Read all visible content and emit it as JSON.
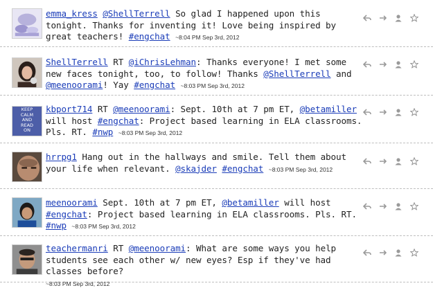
{
  "tweets": [
    {
      "user": "emma_kress",
      "parts": [
        " ",
        "@ShellTerrell",
        " So glad I happened upon this tonight. Thanks for inventing it! Love being inspired by great teachers! ",
        "#engchat"
      ],
      "timestamp": "~8:04 PM Sep 3rd, 2012"
    },
    {
      "user": "ShellTerrell",
      "parts": [
        " RT ",
        "@iChrisLehman",
        ": Thanks everyone! I met some new faces tonight, too, to follow! Thanks ",
        "@ShellTerrell",
        " and ",
        "@meenoorami",
        "! Yay ",
        "#engchat"
      ],
      "timestamp": "~8:03 PM Sep 3rd, 2012"
    },
    {
      "user": "kbport714",
      "avatar_lines": [
        "KEEP",
        "CALM",
        "AND",
        "READ",
        "ON"
      ],
      "parts": [
        " RT ",
        "@meenoorami",
        ": Sept. 10th at 7 pm ET, ",
        "@betamiller",
        " will host ",
        "#engchat",
        ": Project based learning in ELA classrooms. Pls. RT. ",
        "#nwp"
      ],
      "timestamp": "~8:03 PM Sep 3rd, 2012"
    },
    {
      "user": "hrrpg1",
      "parts": [
        " Hang out in the hallways and smile. Tell them about your life when relevant. ",
        "@skajder",
        " ",
        "#engchat"
      ],
      "timestamp": "~8:03 PM Sep 3rd, 2012"
    },
    {
      "user": "meenoorami",
      "parts": [
        " Sept. 10th at 7 pm ET, ",
        "@betamiller",
        " will host ",
        "#engchat",
        ": Project based learning in ELA classrooms. Pls. RT. ",
        "#nwp"
      ],
      "timestamp": "~8:03 PM Sep 3rd, 2012"
    },
    {
      "user": "teachermanri",
      "parts": [
        " RT ",
        "@meenoorami",
        ": What are some ways you help students see each other w/ new eyes? Esp if they've had classes before?"
      ],
      "timestamp": "~8:03 PM Sep 3rd, 2012"
    }
  ],
  "actions": [
    "reply-icon",
    "retweet-icon",
    "user-icon",
    "favorite-star-icon"
  ],
  "colors": {
    "link": "#1a3cb8",
    "divider": "#bdbdbd",
    "icon": "#9a9a9a"
  }
}
